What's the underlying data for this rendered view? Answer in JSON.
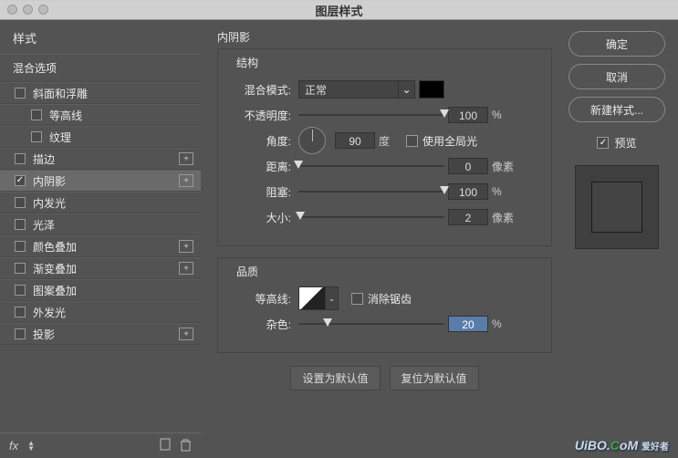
{
  "title": "图层样式",
  "sidebar": {
    "header": "样式",
    "blend_options": "混合选项",
    "items": [
      {
        "label": "斜面和浮雕",
        "checked": false,
        "add": false,
        "level": 1
      },
      {
        "label": "等高线",
        "checked": false,
        "add": false,
        "level": 2
      },
      {
        "label": "纹理",
        "checked": false,
        "add": false,
        "level": 2
      },
      {
        "label": "描边",
        "checked": false,
        "add": true,
        "level": 1
      },
      {
        "label": "内阴影",
        "checked": true,
        "add": true,
        "level": 1,
        "selected": true
      },
      {
        "label": "内发光",
        "checked": false,
        "add": false,
        "level": 1
      },
      {
        "label": "光泽",
        "checked": false,
        "add": false,
        "level": 1
      },
      {
        "label": "颜色叠加",
        "checked": false,
        "add": true,
        "level": 1
      },
      {
        "label": "渐变叠加",
        "checked": false,
        "add": true,
        "level": 1
      },
      {
        "label": "图案叠加",
        "checked": false,
        "add": false,
        "level": 1
      },
      {
        "label": "外发光",
        "checked": false,
        "add": false,
        "level": 1
      },
      {
        "label": "投影",
        "checked": false,
        "add": true,
        "level": 1
      }
    ],
    "fx_label": "fx"
  },
  "center": {
    "title": "内阴影",
    "structure": {
      "title": "结构",
      "blend_mode_label": "混合模式:",
      "blend_mode_value": "正常",
      "swatch_color": "#000000",
      "opacity_label": "不透明度:",
      "opacity_value": "100",
      "opacity_unit": "%",
      "angle_label": "角度:",
      "angle_value": "90",
      "angle_unit": "度",
      "global_light_label": "使用全局光",
      "global_light_checked": false,
      "distance_label": "距离:",
      "distance_value": "0",
      "distance_unit": "像素",
      "choke_label": "阻塞:",
      "choke_value": "100",
      "choke_unit": "%",
      "size_label": "大小:",
      "size_value": "2",
      "size_unit": "像素"
    },
    "quality": {
      "title": "品质",
      "contour_label": "等高线:",
      "antialias_label": "消除锯齿",
      "antialias_checked": false,
      "noise_label": "杂色:",
      "noise_value": "20",
      "noise_unit": "%"
    },
    "buttons": {
      "make_default": "设置为默认值",
      "reset_default": "复位为默认值"
    }
  },
  "right": {
    "ok": "确定",
    "cancel": "取消",
    "new_style": "新建样式...",
    "preview_label": "预览",
    "preview_checked": true
  },
  "footer": {
    "watermark_prefix": "UiBO.",
    "watermark_c": "C",
    "watermark_om": "oM",
    "watermark_cn": "爱好者"
  }
}
